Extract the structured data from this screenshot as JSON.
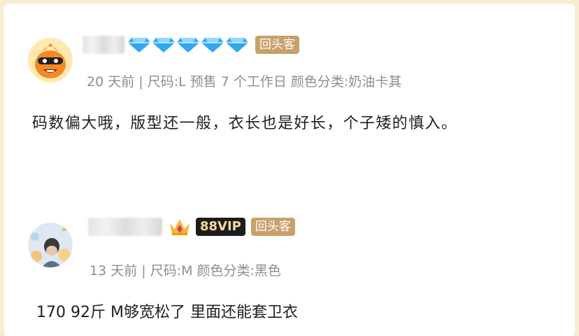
{
  "reviews": [
    {
      "badge": "回头客",
      "meta": "20 天前 | 尺码:L 预售 7 个工作日 颜色分类:奶油卡其",
      "content": "码数偏大哦，版型还一般，衣长也是好长，个子矮的慎入。"
    },
    {
      "vip": "88VIP",
      "badge": "回头客",
      "meta": "13 天前 | 尺码:M 颜色分类:黑色",
      "content": "170 92斤 M够宽松了 里面还能套卫衣"
    }
  ],
  "colors": {
    "background": "#f7edd4",
    "meta_text": "#8d8d8d",
    "badge_returning": "#c8a06a",
    "badge_vip_bg": "#1c1c1c",
    "diamond": "#2fa8f2"
  }
}
